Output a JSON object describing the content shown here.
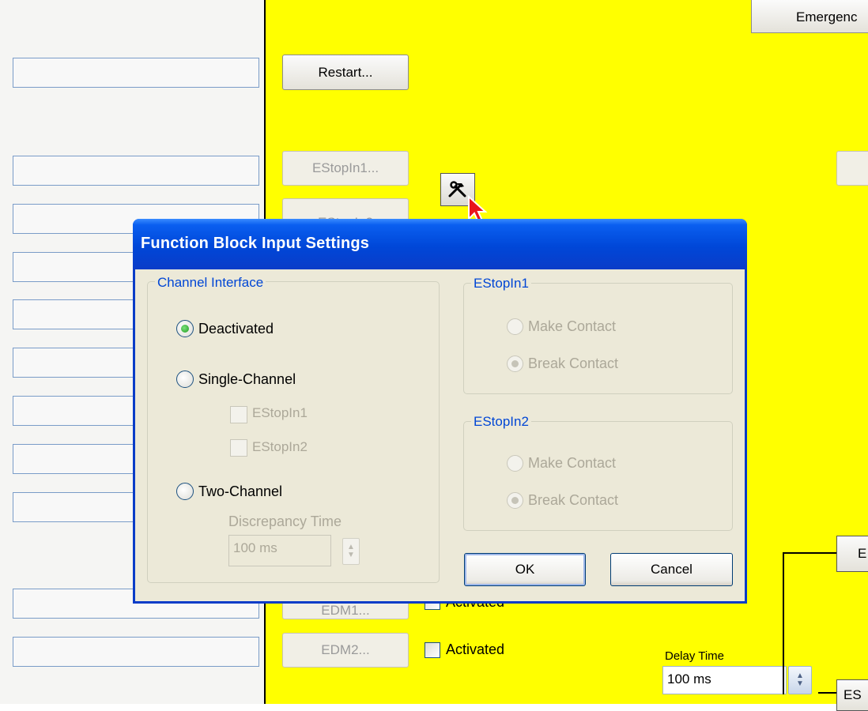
{
  "top": {
    "emergency_label": "Emergenc"
  },
  "buttons": {
    "restart": "Restart...",
    "estopin1": "EStopIn1...",
    "estopin2": "EStopIn2",
    "edm1": "EDM1...",
    "edm2": "EDM2..."
  },
  "edm1_checkbox_label": "Activated",
  "edm2_checkbox_label": "Activated",
  "delay": {
    "label": "Delay Time",
    "value": "100 ms"
  },
  "right_stub_labels": {
    "top": "E",
    "bottom": "ES"
  },
  "dialog": {
    "title": "Function Block Input Settings",
    "channel_interface": {
      "legend": "Channel Interface",
      "options": {
        "deactivated": "Deactivated",
        "single": "Single-Channel",
        "two": "Two-Channel"
      },
      "single_checks": {
        "estopin1": "EStopIn1",
        "estopin2": "EStopIn2"
      },
      "discrepancy_label": "Discrepancy Time",
      "discrepancy_value": "100 ms"
    },
    "estopin1": {
      "legend": "EStopIn1",
      "make": "Make Contact",
      "break": "Break Contact"
    },
    "estopin2": {
      "legend": "EStopIn2",
      "make": "Make Contact",
      "break": "Break Contact"
    },
    "ok_label": "OK",
    "cancel_label": "Cancel"
  },
  "icons": {
    "tool": "hammer-wrench-icon",
    "cursor": "mouse-pointer-icon",
    "spinner": "spinner-arrows-icon"
  },
  "colors": {
    "canvas": "#ffff00",
    "title_bar": "#0a3cc8",
    "group_legend": "#0046d5",
    "selected_radio": "#1f9a1f"
  }
}
